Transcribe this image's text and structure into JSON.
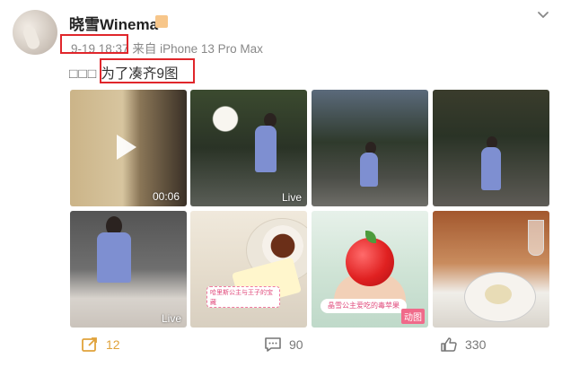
{
  "post": {
    "username": "晓雪Winema",
    "time": "9-19 18:37",
    "source": "来自 iPhone 13 Pro Max",
    "caption_prefix": "□□□",
    "caption": "为了凑齐9图"
  },
  "media": {
    "video_duration": "00:06",
    "live_label": "Live",
    "gif_label": "动图",
    "sticker_left": "哈里斯公主与王子的宝藏",
    "sticker_apple": "晶雪公主爱吃的毒苹果"
  },
  "actions": {
    "repost_count": "12",
    "comment_count": "90",
    "like_count": "330"
  },
  "colors": {
    "highlight_box": "#e0262b",
    "repost_accent": "#e0a23b",
    "gif_badge": "#f06a8a"
  },
  "icons": [
    "chevron-down-icon",
    "play-icon",
    "repost-icon",
    "comment-icon",
    "like-icon"
  ]
}
